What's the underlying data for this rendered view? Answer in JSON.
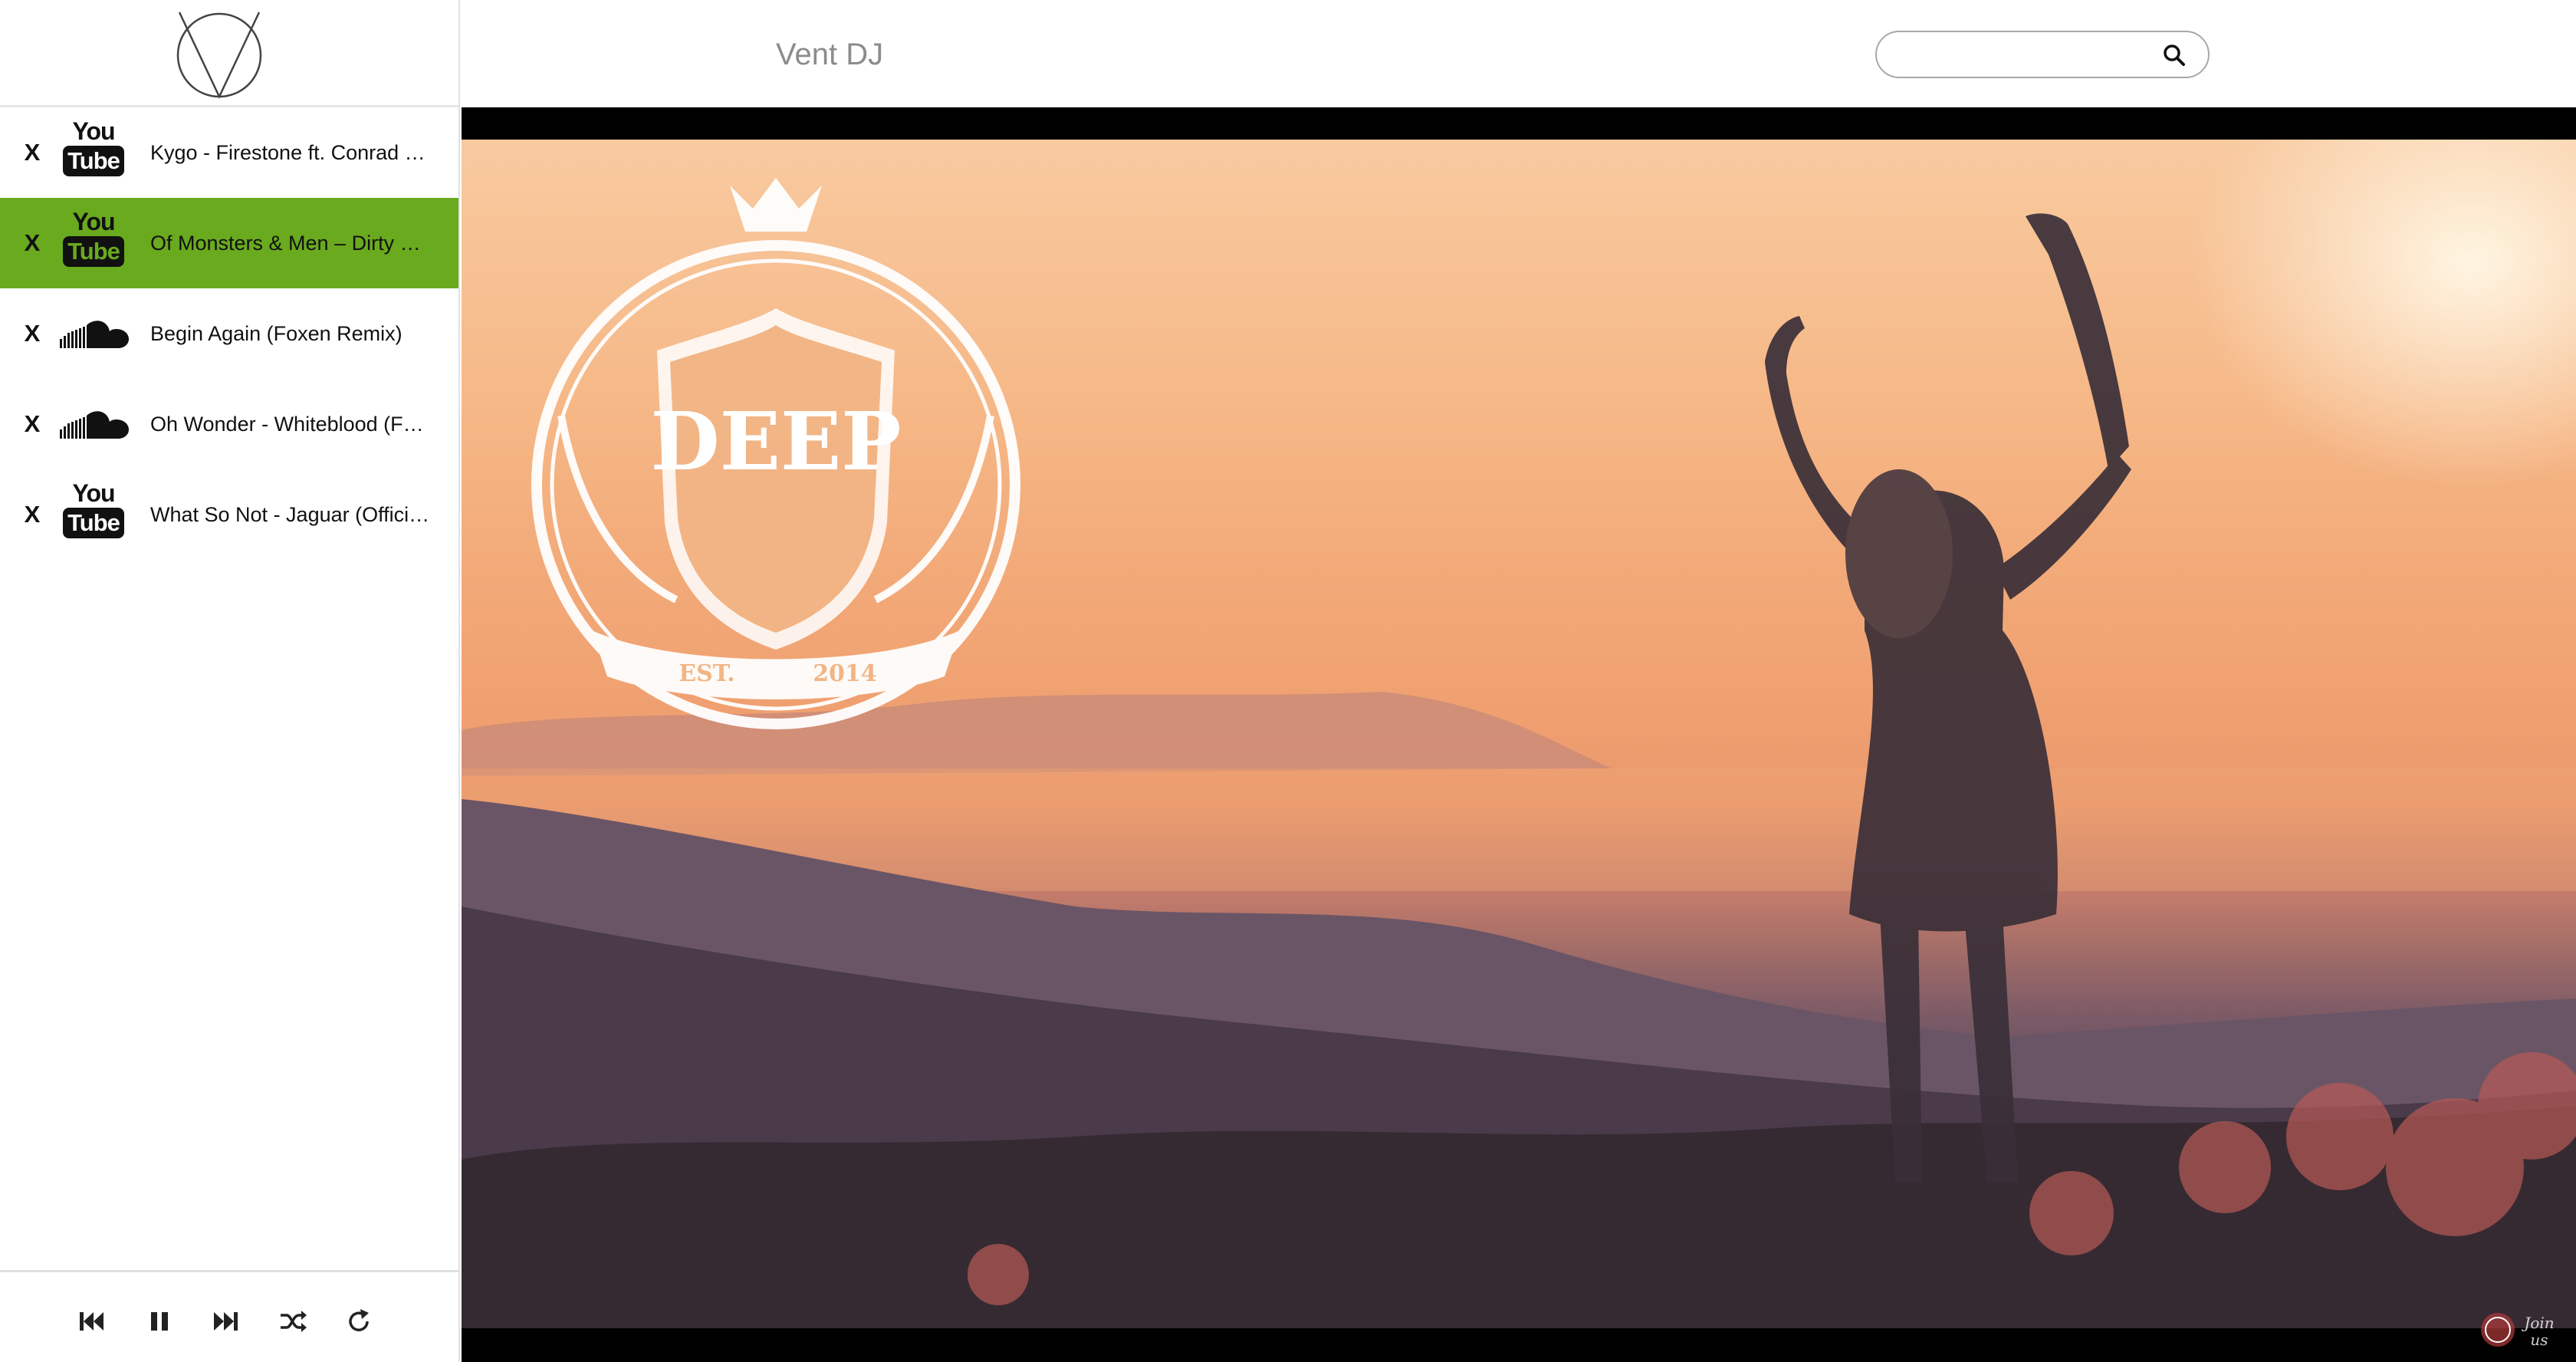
{
  "app": {
    "title": "Vent DJ"
  },
  "search": {
    "placeholder": "",
    "value": ""
  },
  "playlist": {
    "tracks": [
      {
        "source": "youtube",
        "title": "Kygo - Firestone ft. Conrad Sewell",
        "remove_label": "X",
        "active": false
      },
      {
        "source": "youtube",
        "title": "Of Monsters & Men – Dirty Paws",
        "remove_label": "X",
        "active": true
      },
      {
        "source": "soundcloud",
        "title": "Begin Again (Foxen Remix)",
        "remove_label": "X",
        "active": false
      },
      {
        "source": "soundcloud",
        "title": "Oh Wonder - Whiteblood (Foxen Remix)",
        "remove_label": "X",
        "active": false
      },
      {
        "source": "youtube",
        "title": "What So Not - Jaguar (Official Video)",
        "remove_label": "X",
        "active": false
      }
    ],
    "youtube_logo": {
      "top": "You",
      "bottom": "Tube"
    }
  },
  "player_controls": {
    "icons": [
      "previous-icon",
      "pause-icon",
      "next-icon",
      "shuffle-icon",
      "repeat-icon"
    ]
  },
  "video": {
    "overlay_logo": {
      "text": "DEEP",
      "est_left": "EST.",
      "est_right": "2014"
    },
    "corner_badge": "Join us"
  },
  "colors": {
    "active_track": "#6aaa1e",
    "title_text": "#8c8c8c"
  }
}
